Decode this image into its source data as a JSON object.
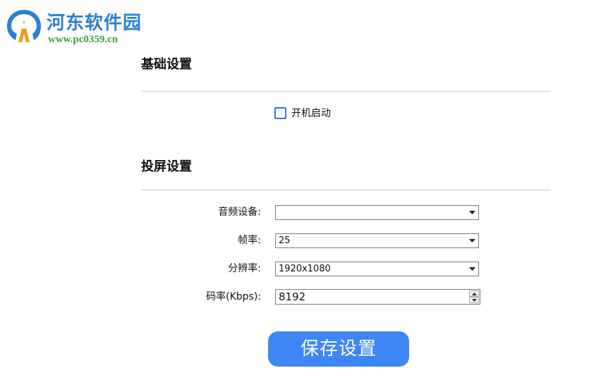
{
  "watermark": {
    "site_name": "河东软件园",
    "url": "www.pc0359.cn"
  },
  "basic": {
    "title": "基础设置",
    "autostart_label": "开机启动",
    "autostart_checked": false
  },
  "cast": {
    "title": "投屏设置",
    "audio_device": {
      "label": "音频设备:",
      "value": ""
    },
    "frame_rate": {
      "label": "帧率:",
      "value": "25"
    },
    "resolution": {
      "label": "分辨率:",
      "value": "1920x1080"
    },
    "bitrate": {
      "label": "码率(Kbps):",
      "value": "8192"
    }
  },
  "save_button": "保存设置",
  "colors": {
    "accent": "#3e86f5",
    "divider": "#b9d3e6",
    "checkbox_border": "#3a78e0",
    "watermark_blue": "#2b7fd4",
    "watermark_green": "#3aa33a"
  }
}
